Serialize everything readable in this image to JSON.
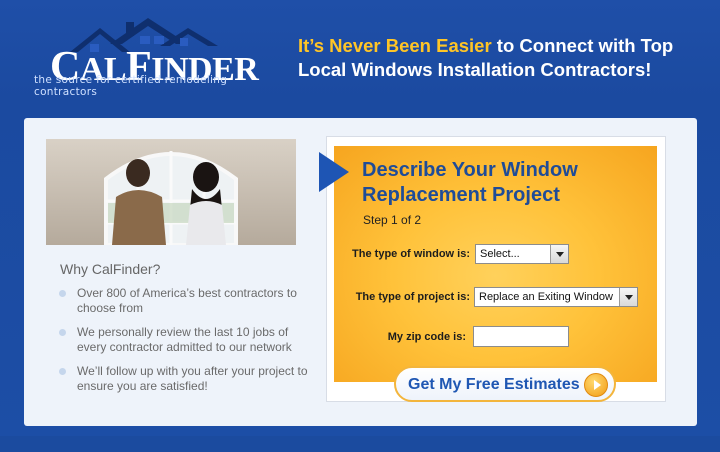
{
  "brand": {
    "logo_text": "CalFinder",
    "tagline": "the source for certified remodeling contractors"
  },
  "header": {
    "headline_accent": "It’s Never Been Easier",
    "headline_rest": " to Connect with Top Local Windows Installation Contractors!"
  },
  "why": {
    "title": "Why CalFinder?",
    "bullets": [
      "Over 800 of America’s best contractors to choose from",
      "We personally review the last 10 jobs of every contractor admitted to our network",
      "We’ll follow up with you after your project to ensure you are satisfied!"
    ]
  },
  "form": {
    "title": "Describe Your Window Replacement Project",
    "step": "Step 1 of 2",
    "window_type_label": "The type of window is:",
    "window_type_value": "Select...",
    "project_type_label": "The type of project is:",
    "project_type_value": "Replace an Exiting Window",
    "zip_label": "My zip code is:",
    "zip_value": "",
    "submit_label": "Get My Free Estimates"
  },
  "colors": {
    "brand_blue": "#1f4fa8",
    "accent_yellow": "#ffc526",
    "form_orange": "#ffc23a",
    "title_blue": "#1f4c98"
  },
  "icons": {
    "logo_house": "house-roof-icon",
    "form_arrow": "right-arrow-icon",
    "submit_play": "play-circle-icon",
    "dropdown": "chevron-down-icon"
  }
}
